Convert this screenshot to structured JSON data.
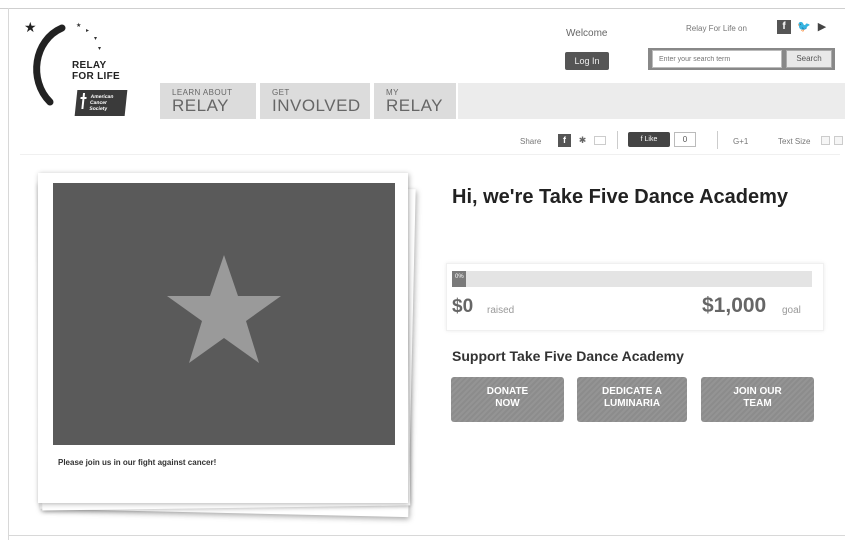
{
  "header": {
    "logo_line1": "RELAY",
    "logo_line2": "FOR LIFE",
    "acs_text": "American Cancer Society",
    "welcome": "Welcome",
    "login_label": "Log In",
    "relay_social": "Relay For Life on",
    "search_placeholder": "Enter your search term",
    "search_label": "Search"
  },
  "nav": {
    "tabs": [
      {
        "small": "LEARN ABOUT",
        "big": "RELAY"
      },
      {
        "small": "GET",
        "big": "INVOLVED"
      },
      {
        "small": "MY",
        "big": "RELAY"
      }
    ]
  },
  "share": {
    "label": "Share",
    "like_label": "Like",
    "like_count": "0",
    "g1": "G+1",
    "text_size": "Text Size"
  },
  "photo": {
    "caption": "Please join us in our fight against cancer!"
  },
  "page": {
    "title": "Hi, we're Take Five Dance Academy",
    "raised_amount": "$0",
    "raised_label": "raised",
    "goal_amount": "$1,000",
    "goal_label": "goal",
    "progress_pct_label": "0%",
    "progress_fraction": 0.0,
    "support_heading": "Support Take Five Dance Academy",
    "donate_label": "DONATE NOW",
    "luminaria_label": "DEDICATE A LUMINARIA",
    "join_label": "JOIN OUR TEAM"
  },
  "colors": {
    "button_gray": "#8c8c8c",
    "nav_tab": "#dcdcdc",
    "photo_bg": "#5a5a5a",
    "star": "#9a9a9a"
  },
  "icons": [
    "facebook-icon",
    "twitter-icon",
    "youtube-icon",
    "delicious-icon",
    "email-icon",
    "star-icon",
    "cross-icon"
  ]
}
